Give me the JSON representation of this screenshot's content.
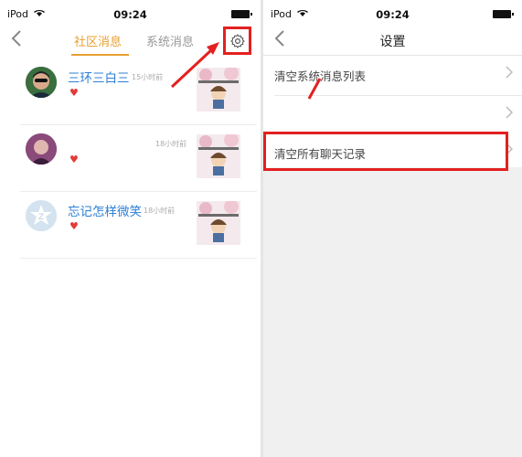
{
  "left": {
    "status": {
      "carrier": "iPod",
      "time": "09:24"
    },
    "tabs": {
      "community": "社区消息",
      "system": "系统消息"
    },
    "messages": [
      {
        "name": "三环三白三",
        "time": "15小时前"
      },
      {
        "name": "",
        "time": "18小时前"
      },
      {
        "name": "忘记怎样微笑",
        "time": "18小时前"
      }
    ]
  },
  "right": {
    "status": {
      "carrier": "iPod",
      "time": "09:24"
    },
    "title": "设置",
    "rows": [
      {
        "label": "清空系统消息列表"
      },
      {
        "label": ""
      },
      {
        "label": "清空所有聊天记录"
      }
    ]
  },
  "colors": {
    "accent": "#e8a032",
    "link": "#2c7fd6",
    "highlight": "#e32020"
  },
  "icons": {
    "back": "chevron-left-icon",
    "settings": "gear-icon",
    "row": "chevron-right-icon",
    "like": "heart-icon"
  }
}
